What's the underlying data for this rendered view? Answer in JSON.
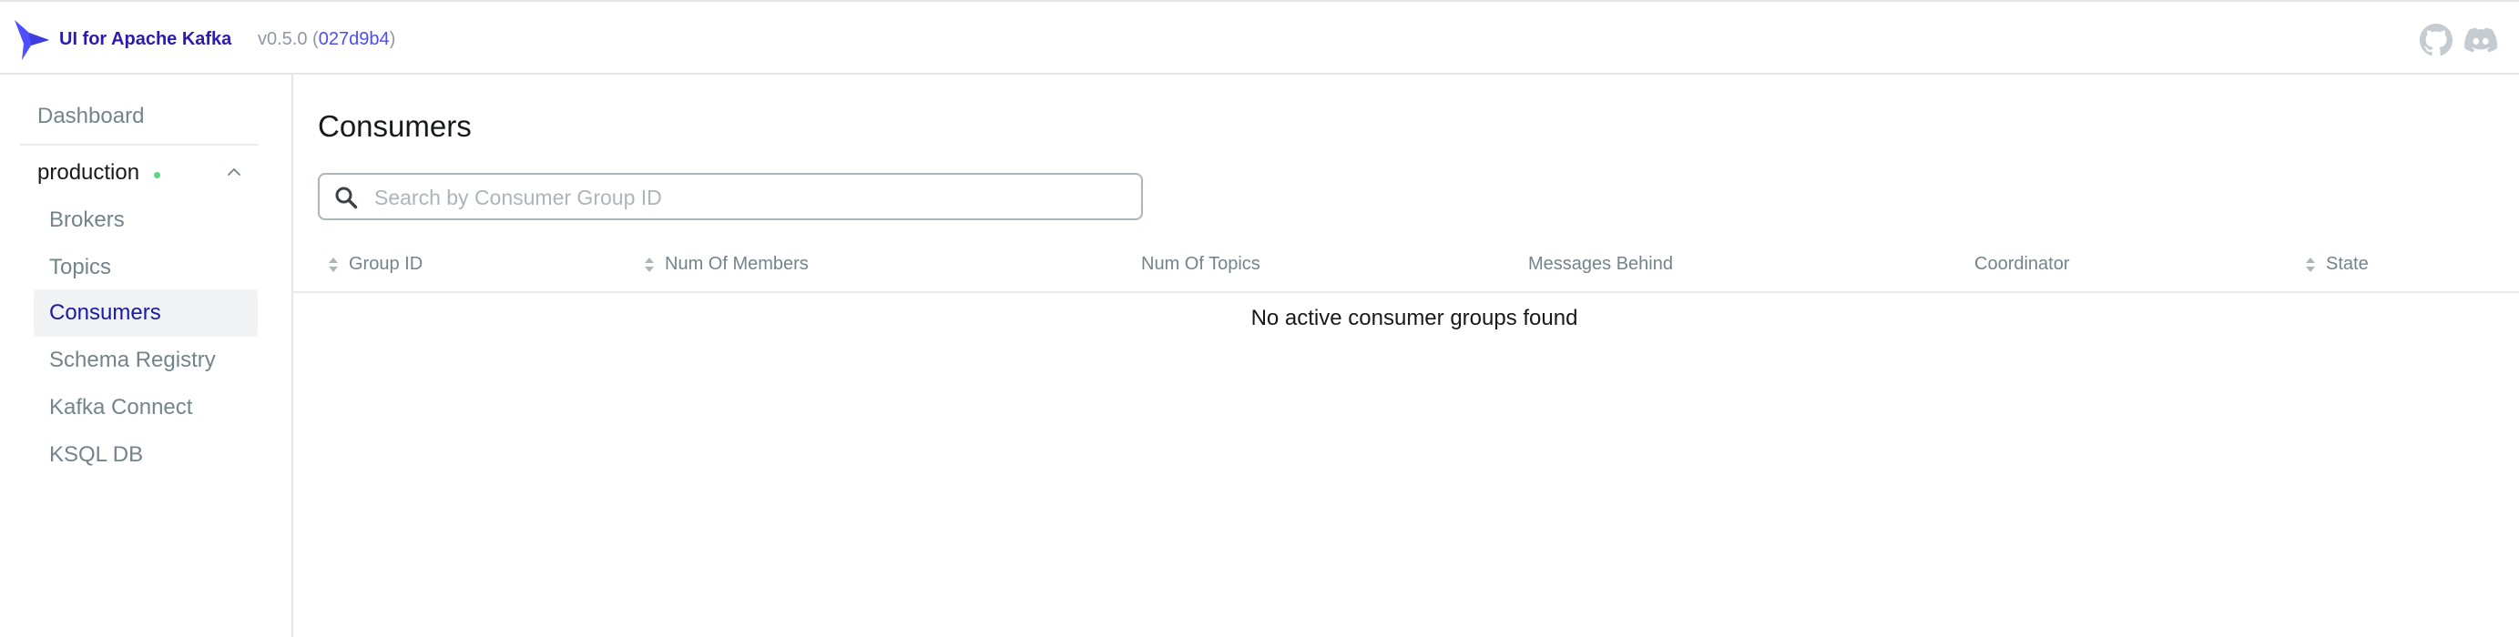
{
  "header": {
    "app_title": "UI for Apache Kafka",
    "version_prefix": "v0.5.0 (",
    "commit": "027d9b4",
    "version_suffix": ")",
    "icons": [
      "github-icon",
      "discord-icon"
    ]
  },
  "sidebar": {
    "dashboard_label": "Dashboard",
    "cluster": {
      "name": "production",
      "status": "online"
    },
    "items": [
      {
        "label": "Brokers",
        "active": false
      },
      {
        "label": "Topics",
        "active": false
      },
      {
        "label": "Consumers",
        "active": true
      },
      {
        "label": "Schema Registry",
        "active": false
      },
      {
        "label": "Kafka Connect",
        "active": false
      },
      {
        "label": "KSQL DB",
        "active": false
      }
    ]
  },
  "main": {
    "title": "Consumers",
    "search": {
      "placeholder": "Search by Consumer Group ID",
      "value": ""
    },
    "table": {
      "columns": [
        {
          "label": "Group ID",
          "sortable": true
        },
        {
          "label": "Num Of Members",
          "sortable": true
        },
        {
          "label": "Num Of Topics",
          "sortable": false
        },
        {
          "label": "Messages Behind",
          "sortable": false
        },
        {
          "label": "Coordinator",
          "sortable": false
        },
        {
          "label": "State",
          "sortable": true
        }
      ],
      "empty_message": "No active consumer groups found"
    }
  },
  "colors": {
    "brand": "#2b1bb3",
    "logo": "#4f4ffe",
    "active_item": "#1a1aa6",
    "status_online": "#5cd685"
  }
}
